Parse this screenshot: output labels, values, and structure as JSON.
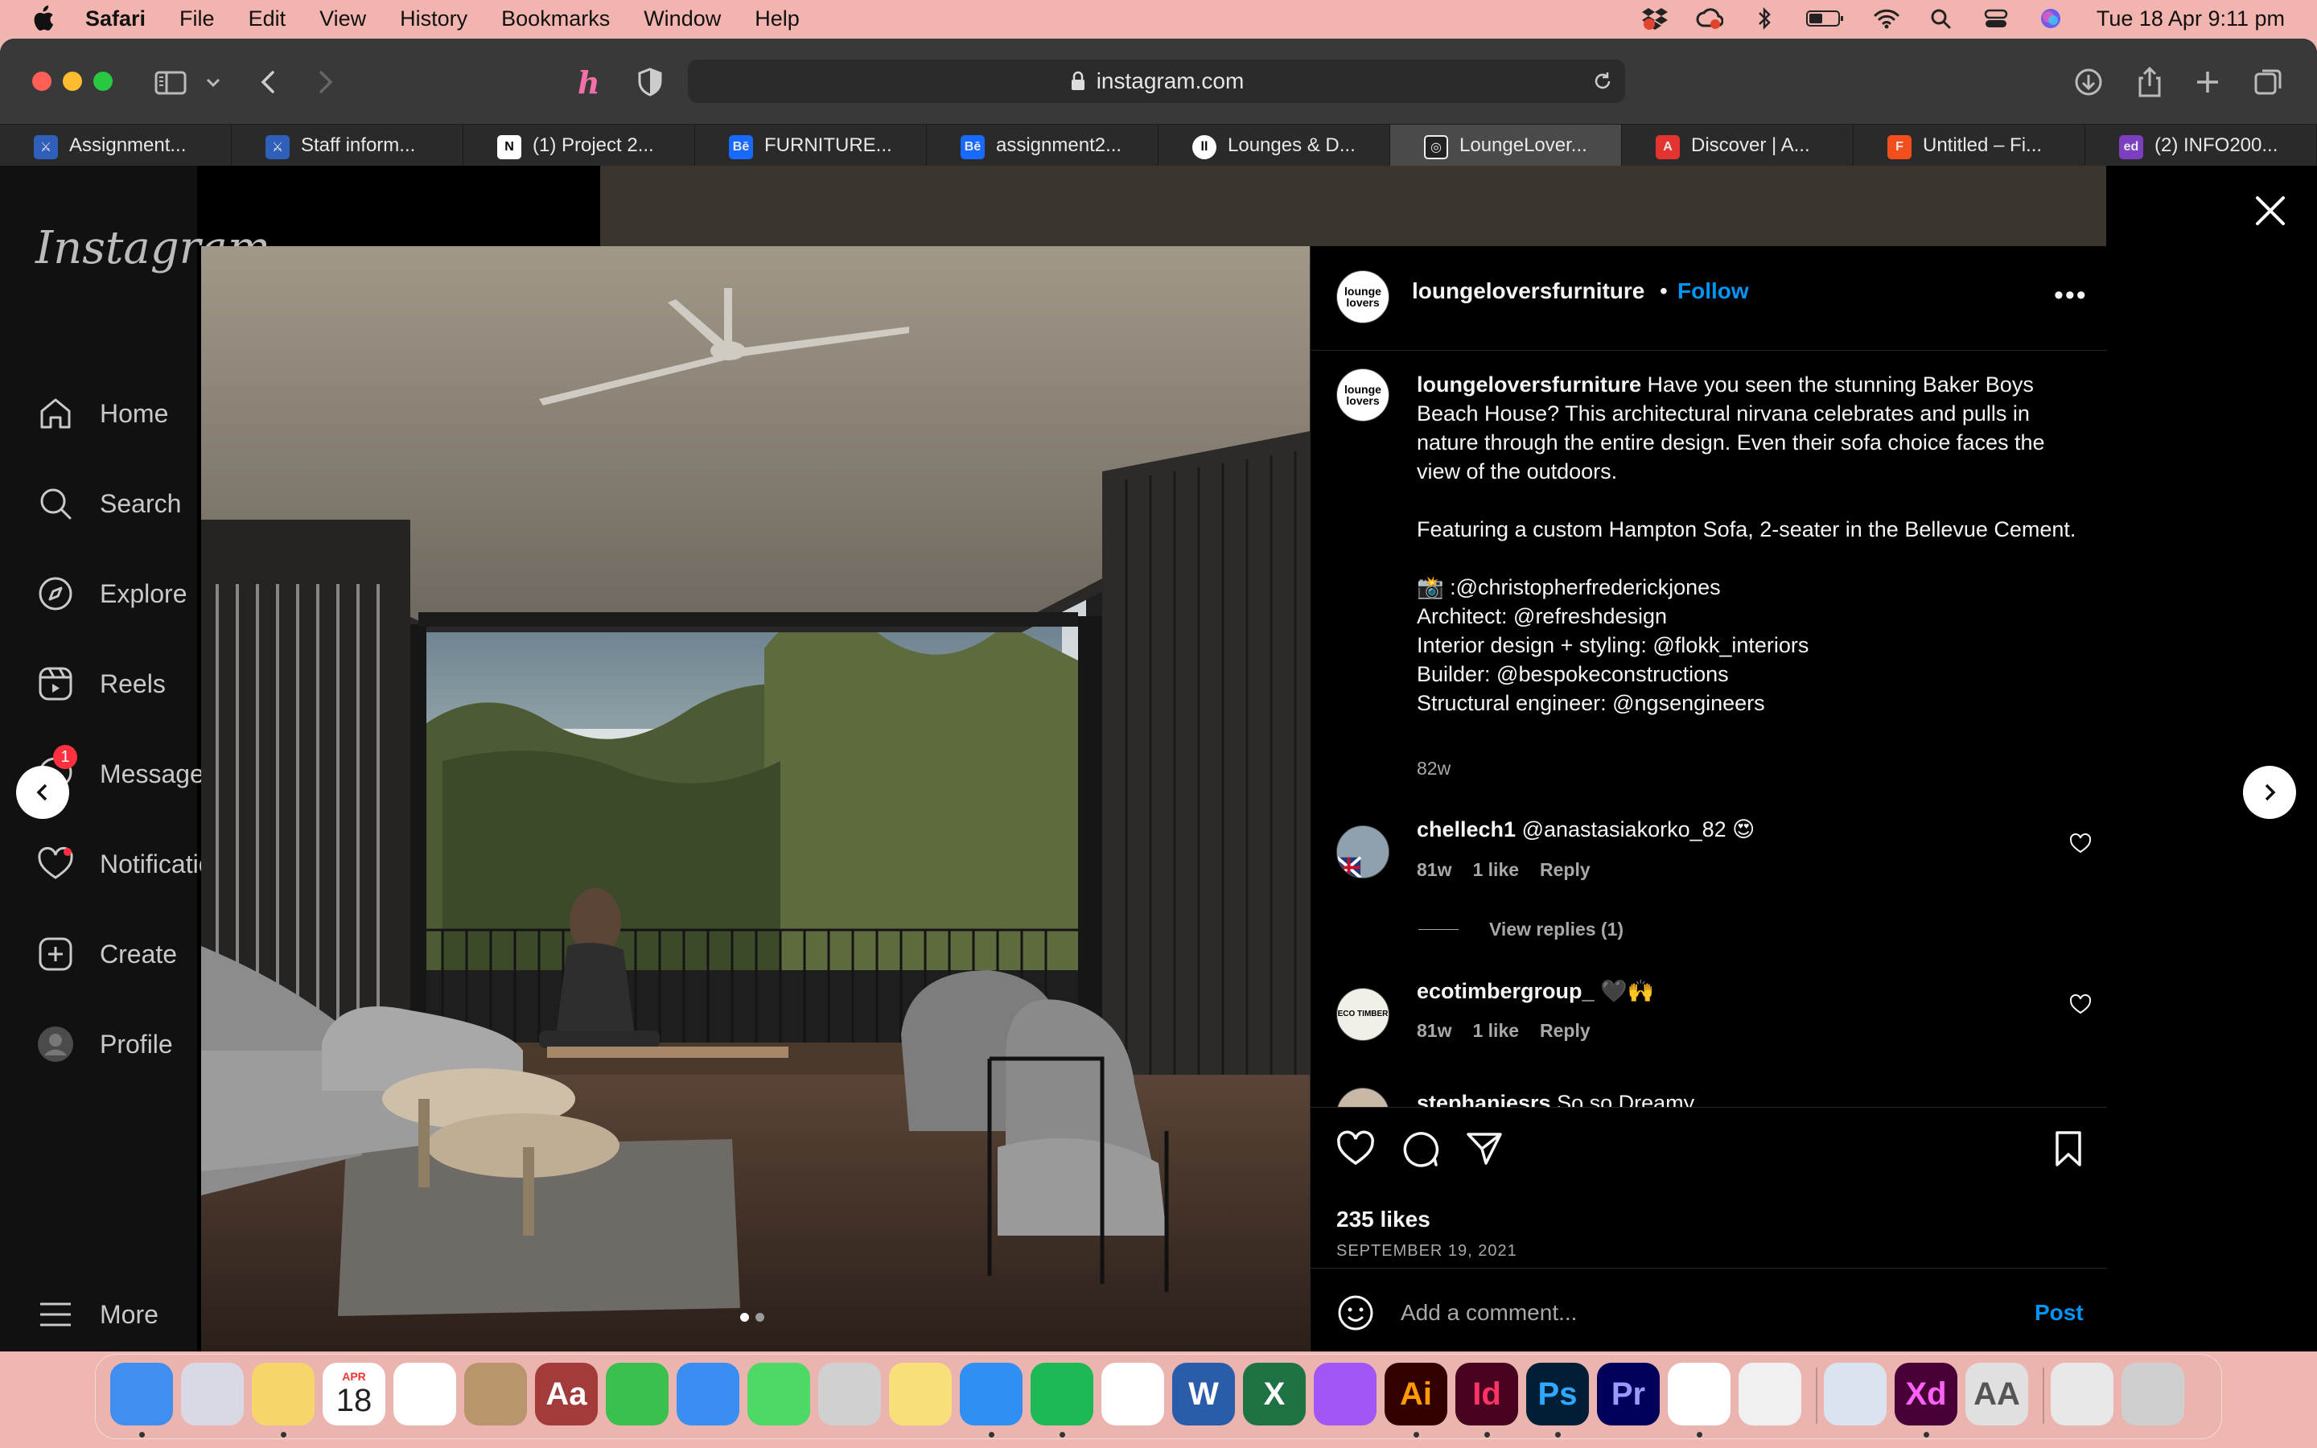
{
  "menubar": {
    "app": "Safari",
    "items": [
      "File",
      "Edit",
      "View",
      "History",
      "Bookmarks",
      "Window",
      "Help"
    ],
    "clock": "Tue 18 Apr  9:11 pm"
  },
  "browser": {
    "url": "instagram.com",
    "tabs": [
      {
        "label": "Assignment...",
        "fav_color": "#2f5fb8",
        "fav_text": "⚔"
      },
      {
        "label": "Staff inform...",
        "fav_color": "#2f5fb8",
        "fav_text": "⚔"
      },
      {
        "label": "(1) Project 2...",
        "fav_color": "#ffffff",
        "fav_text": "N"
      },
      {
        "label": "FURNITURE...",
        "fav_color": "#1769ff",
        "fav_text": "Bē"
      },
      {
        "label": "assignment2...",
        "fav_color": "#1769ff",
        "fav_text": "Bē"
      },
      {
        "label": "Lounges & D...",
        "fav_color": "#ffffff",
        "fav_text": "ll"
      },
      {
        "label": "LoungeLover...",
        "fav_color": "#222222",
        "fav_text": "◎"
      },
      {
        "label": "Discover | A...",
        "fav_color": "#e3342f",
        "fav_text": "A"
      },
      {
        "label": "Untitled – Fi...",
        "fav_color": "#f24e1e",
        "fav_text": "F"
      },
      {
        "label": "(2) INFO200...",
        "fav_color": "#7b3fbf",
        "fav_text": "ed"
      }
    ]
  },
  "sidebar": {
    "logo": "Instagram",
    "items": [
      {
        "label": "Home",
        "icon": "home-icon"
      },
      {
        "label": "Search",
        "icon": "search-icon"
      },
      {
        "label": "Explore",
        "icon": "compass-icon"
      },
      {
        "label": "Reels",
        "icon": "reels-icon"
      },
      {
        "label": "Messages",
        "icon": "messenger-icon",
        "badge": "1"
      },
      {
        "label": "Notifications",
        "icon": "heart-icon"
      },
      {
        "label": "Create",
        "icon": "plus-square-icon"
      },
      {
        "label": "Profile",
        "icon": "avatar-icon"
      }
    ],
    "more": "More"
  },
  "post": {
    "username": "loungeloversfurniture",
    "follow": "Follow",
    "avatar_text": "lounge lovers",
    "caption_user": "loungeloversfurniture",
    "caption_lines": [
      " Have you seen the stunning Baker Boys Beach House? This architectural nirvana celebrates and pulls in nature through the entire design. Even their sofa choice faces the view of the outdoors.",
      "Featuring a custom Hampton Sofa, 2-seater in the Bellevue Cement.",
      "📸 :@christopherfrederickjones",
      "Architect: @refreshdesign",
      "Interior design + styling: @flokk_interiors",
      "Builder: @bespokeconstructions",
      "Structural engineer: @ngsengineers"
    ],
    "caption_time": "82w",
    "comments": [
      {
        "user": "chellech1",
        "text": " @anastasiakorko_82 😍",
        "time": "81w",
        "likes": "1 like",
        "reply": "Reply"
      },
      {
        "user": "ecotimbergroup_",
        "text": " 🖤🙌",
        "time": "81w",
        "likes": "1 like",
        "reply": "Reply"
      },
      {
        "user": "stephaniesrs",
        "text": " So so Dreamy"
      }
    ],
    "view_replies": "View replies (1)",
    "likes": "235 likes",
    "date": "SEPTEMBER 19, 2021",
    "comment_placeholder": "Add a comment...",
    "post_button": "Post"
  },
  "dock": {
    "apps": [
      {
        "name": "Finder",
        "color": "#3f8ef0",
        "label": ""
      },
      {
        "name": "Launchpad",
        "color": "#d9d9e6",
        "label": ""
      },
      {
        "name": "Notes",
        "color": "#f6d66a",
        "label": ""
      },
      {
        "name": "Calendar",
        "color": "#ffffff",
        "label": "18",
        "month": "APR"
      },
      {
        "name": "Photos",
        "color": "#ffffff",
        "label": ""
      },
      {
        "name": "Contacts",
        "color": "#b8956a",
        "label": ""
      },
      {
        "name": "Dictionary",
        "color": "#a33b3b",
        "label": "Aa"
      },
      {
        "name": "FaceTime",
        "color": "#3ac04c",
        "label": ""
      },
      {
        "name": "Mail",
        "color": "#3a8ef2",
        "label": ""
      },
      {
        "name": "Messages",
        "color": "#4cd964",
        "label": ""
      },
      {
        "name": "Calculator",
        "color": "#d0d0d0",
        "label": ""
      },
      {
        "name": "Notes2",
        "color": "#f7e07a",
        "label": ""
      },
      {
        "name": "Safari",
        "color": "#2f8ff2",
        "label": ""
      },
      {
        "name": "Spotify",
        "color": "#1db954",
        "label": ""
      },
      {
        "name": "Chrome",
        "color": "#ffffff",
        "label": ""
      },
      {
        "name": "Word",
        "color": "#2b5caa",
        "label": "W"
      },
      {
        "name": "Excel",
        "color": "#1f7244",
        "label": "X"
      },
      {
        "name": "Messenger",
        "color": "#a256f5",
        "label": ""
      },
      {
        "name": "Illustrator",
        "color": "#330000",
        "label": "Ai",
        "text_color": "#ff9a00"
      },
      {
        "name": "InDesign",
        "color": "#49021f",
        "label": "Id",
        "text_color": "#ff3366"
      },
      {
        "name": "Photoshop",
        "color": "#001e36",
        "label": "Ps",
        "text_color": "#31a8ff"
      },
      {
        "name": "Premiere",
        "color": "#00005b",
        "label": "Pr",
        "text_color": "#9999ff"
      },
      {
        "name": "VS Code",
        "color": "#ffffff",
        "label": ""
      },
      {
        "name": "Blender",
        "color": "#f0f0f0",
        "label": ""
      },
      {
        "name": "Preview",
        "color": "#d9e4f0",
        "label": ""
      },
      {
        "name": "XD",
        "color": "#470137",
        "label": "Xd",
        "text_color": "#ff61f6"
      },
      {
        "name": "Font Book",
        "color": "#e0e0e0",
        "label": "AA",
        "text_color": "#555555"
      },
      {
        "name": "Archive",
        "color": "#e8e8e8",
        "label": ""
      },
      {
        "name": "Trash",
        "color": "#cfcfcf",
        "label": ""
      }
    ]
  }
}
